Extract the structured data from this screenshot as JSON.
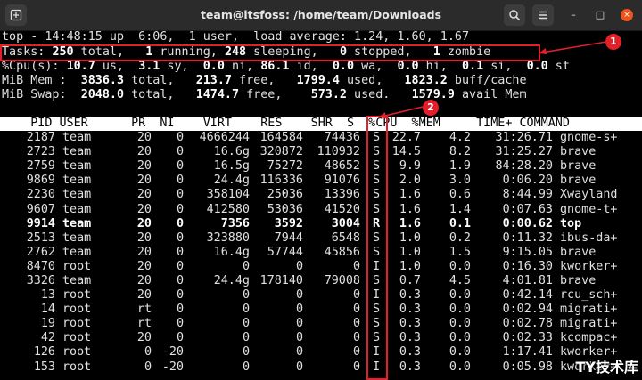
{
  "window": {
    "title": "team@itsfoss: /home/team/Downloads",
    "icons": {
      "new_tab": "new-tab-icon",
      "search": "search-icon",
      "menu": "hamburger-menu-icon"
    },
    "minimize": "–",
    "maximize": "□",
    "close": "×"
  },
  "summary": {
    "uptime_line": "top - 14:48:15 up  6:06,  1 user,  load average: 1.24, 1.60, 1.67",
    "tasks_label": "Tasks: ",
    "tasks_total": "250",
    "tasks_total_label": " total,   ",
    "tasks_running": "1",
    "tasks_running_label": " running, ",
    "tasks_sleeping": "248",
    "tasks_sleeping_label": " sleeping,   ",
    "tasks_stopped": "0",
    "tasks_stopped_label": " stopped,   ",
    "tasks_zombie": "1",
    "tasks_zombie_label": " zombie",
    "cpu_label": "%Cpu(s): ",
    "cpu_us": "10.7",
    "cpu_us_label": " us,  ",
    "cpu_sy": "3.1",
    "cpu_sy_label": " sy,  ",
    "cpu_ni": "0.0",
    "cpu_ni_label": " ni, ",
    "cpu_id": "86.1",
    "cpu_id_label": " id,  ",
    "cpu_wa": "0.0",
    "cpu_wa_label": " wa,  ",
    "cpu_hi": "0.0",
    "cpu_hi_label": " hi,  ",
    "cpu_si": "0.1",
    "cpu_si_label": " si,  ",
    "cpu_st": "0.0",
    "cpu_st_label": " st",
    "mem_label": "MiB Mem :  ",
    "mem_total": "3836.3",
    "mem_total_label": " total,   ",
    "mem_free": "213.7",
    "mem_free_label": " free,   ",
    "mem_used": "1799.4",
    "mem_used_label": " used,   ",
    "mem_buff": "1823.2",
    "mem_buff_label": " buff/cache",
    "swap_label": "MiB Swap:  ",
    "swap_total": "2048.0",
    "swap_total_label": " total,   ",
    "swap_free": "1474.7",
    "swap_free_label": " free,    ",
    "swap_used": "573.2",
    "swap_used_label": " used.   ",
    "swap_avail": "1579.9",
    "swap_avail_label": " avail Mem"
  },
  "columns_line": "    PID USER      PR  NI    VIRT    RES    SHR  S  %CPU  %MEM     TIME+ COMMAND",
  "processes": [
    {
      "pid": "2187",
      "user": "team",
      "pr": "20",
      "ni": "0",
      "virt": "4666244",
      "res": "164584",
      "shr": "74436",
      "s": "S",
      "cpu": "22.7",
      "mem": "4.2",
      "time": "31:26.71",
      "cmd": "gnome-s+"
    },
    {
      "pid": "2723",
      "user": "team",
      "pr": "20",
      "ni": "0",
      "virt": "16.6g",
      "res": "320872",
      "shr": "110932",
      "s": "S",
      "cpu": "14.5",
      "mem": "8.2",
      "time": "31:25.27",
      "cmd": "brave"
    },
    {
      "pid": "2759",
      "user": "team",
      "pr": "20",
      "ni": "0",
      "virt": "16.5g",
      "res": "75272",
      "shr": "48652",
      "s": "S",
      "cpu": "9.9",
      "mem": "1.9",
      "time": "84:28.20",
      "cmd": "brave"
    },
    {
      "pid": "9869",
      "user": "team",
      "pr": "20",
      "ni": "0",
      "virt": "24.4g",
      "res": "116336",
      "shr": "91076",
      "s": "S",
      "cpu": "2.0",
      "mem": "3.0",
      "time": "0:06.20",
      "cmd": "brave"
    },
    {
      "pid": "2230",
      "user": "team",
      "pr": "20",
      "ni": "0",
      "virt": "358104",
      "res": "25036",
      "shr": "13396",
      "s": "S",
      "cpu": "1.6",
      "mem": "0.6",
      "time": "8:44.99",
      "cmd": "Xwayland"
    },
    {
      "pid": "9607",
      "user": "team",
      "pr": "20",
      "ni": "0",
      "virt": "412580",
      "res": "53036",
      "shr": "41520",
      "s": "S",
      "cpu": "1.6",
      "mem": "1.4",
      "time": "0:07.63",
      "cmd": "gnome-t+"
    },
    {
      "pid": "9914",
      "user": "team",
      "pr": "20",
      "ni": "0",
      "virt": "7356",
      "res": "3592",
      "shr": "3004",
      "s": "R",
      "cpu": "1.6",
      "mem": "0.1",
      "time": "0:00.62",
      "cmd": "top",
      "bold": true
    },
    {
      "pid": "2513",
      "user": "team",
      "pr": "20",
      "ni": "0",
      "virt": "323880",
      "res": "7944",
      "shr": "6548",
      "s": "S",
      "cpu": "1.0",
      "mem": "0.2",
      "time": "0:11.32",
      "cmd": "ibus-da+"
    },
    {
      "pid": "2762",
      "user": "team",
      "pr": "20",
      "ni": "0",
      "virt": "16.4g",
      "res": "57744",
      "shr": "45856",
      "s": "S",
      "cpu": "1.0",
      "mem": "1.5",
      "time": "9:15.05",
      "cmd": "brave"
    },
    {
      "pid": "8470",
      "user": "root",
      "pr": "20",
      "ni": "0",
      "virt": "0",
      "res": "0",
      "shr": "0",
      "s": "I",
      "cpu": "1.0",
      "mem": "0.0",
      "time": "0:16.30",
      "cmd": "kworker+"
    },
    {
      "pid": "3326",
      "user": "team",
      "pr": "20",
      "ni": "0",
      "virt": "24.4g",
      "res": "178140",
      "shr": "79008",
      "s": "S",
      "cpu": "0.7",
      "mem": "4.5",
      "time": "4:01.81",
      "cmd": "brave"
    },
    {
      "pid": "13",
      "user": "root",
      "pr": "20",
      "ni": "0",
      "virt": "0",
      "res": "0",
      "shr": "0",
      "s": "I",
      "cpu": "0.3",
      "mem": "0.0",
      "time": "0:42.14",
      "cmd": "rcu_sch+"
    },
    {
      "pid": "14",
      "user": "root",
      "pr": "rt",
      "ni": "0",
      "virt": "0",
      "res": "0",
      "shr": "0",
      "s": "S",
      "cpu": "0.3",
      "mem": "0.0",
      "time": "0:02.94",
      "cmd": "migrati+"
    },
    {
      "pid": "19",
      "user": "root",
      "pr": "rt",
      "ni": "0",
      "virt": "0",
      "res": "0",
      "shr": "0",
      "s": "S",
      "cpu": "0.3",
      "mem": "0.0",
      "time": "0:02.78",
      "cmd": "migrati+"
    },
    {
      "pid": "42",
      "user": "root",
      "pr": "20",
      "ni": "0",
      "virt": "0",
      "res": "0",
      "shr": "0",
      "s": "S",
      "cpu": "0.3",
      "mem": "0.0",
      "time": "0:02.33",
      "cmd": "kcompac+"
    },
    {
      "pid": "126",
      "user": "root",
      "pr": "0",
      "ni": "-20",
      "virt": "0",
      "res": "0",
      "shr": "0",
      "s": "I",
      "cpu": "0.3",
      "mem": "0.0",
      "time": "1:17.41",
      "cmd": "kworker+"
    },
    {
      "pid": "153",
      "user": "root",
      "pr": "0",
      "ni": "-20",
      "virt": "0",
      "res": "0",
      "shr": "0",
      "s": "I",
      "cpu": "0.3",
      "mem": "0.0",
      "time": "0:05.98",
      "cmd": "kworker+"
    }
  ],
  "annotations": {
    "badge1": "1",
    "badge2": "2",
    "color": "#e3202a"
  },
  "watermark": "TY技术库"
}
